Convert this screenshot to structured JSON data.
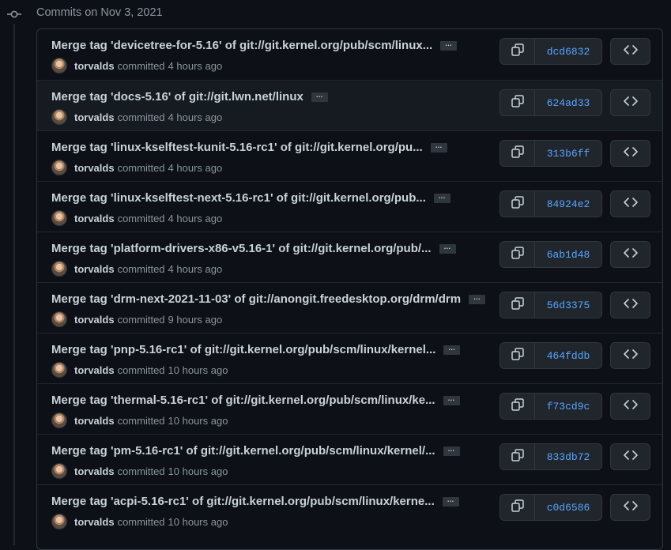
{
  "header": {
    "title": "Commits on Nov 3, 2021"
  },
  "commits": [
    {
      "title": "Merge tag 'devicetree-for-5.16' of git://git.kernel.org/pub/scm/linux...",
      "author": "torvalds",
      "verb": "committed",
      "time": "4 hours ago",
      "sha": "dcd6832"
    },
    {
      "title": "Merge tag 'docs-5.16' of git://git.lwn.net/linux",
      "author": "torvalds",
      "verb": "committed",
      "time": "4 hours ago",
      "sha": "624ad33"
    },
    {
      "title": "Merge tag 'linux-kselftest-kunit-5.16-rc1' of git://git.kernel.org/pu...",
      "author": "torvalds",
      "verb": "committed",
      "time": "4 hours ago",
      "sha": "313b6ff"
    },
    {
      "title": "Merge tag 'linux-kselftest-next-5.16-rc1' of git://git.kernel.org/pub...",
      "author": "torvalds",
      "verb": "committed",
      "time": "4 hours ago",
      "sha": "84924e2"
    },
    {
      "title": "Merge tag 'platform-drivers-x86-v5.16-1' of git://git.kernel.org/pub/...",
      "author": "torvalds",
      "verb": "committed",
      "time": "4 hours ago",
      "sha": "6ab1d48"
    },
    {
      "title": "Merge tag 'drm-next-2021-11-03' of git://anongit.freedesktop.org/drm/drm",
      "author": "torvalds",
      "verb": "committed",
      "time": "9 hours ago",
      "sha": "56d3375"
    },
    {
      "title": "Merge tag 'pnp-5.16-rc1' of git://git.kernel.org/pub/scm/linux/kernel...",
      "author": "torvalds",
      "verb": "committed",
      "time": "10 hours ago",
      "sha": "464fddb"
    },
    {
      "title": "Merge tag 'thermal-5.16-rc1' of git://git.kernel.org/pub/scm/linux/ke...",
      "author": "torvalds",
      "verb": "committed",
      "time": "10 hours ago",
      "sha": "f73cd9c"
    },
    {
      "title": "Merge tag 'pm-5.16-rc1' of git://git.kernel.org/pub/scm/linux/kernel/...",
      "author": "torvalds",
      "verb": "committed",
      "time": "10 hours ago",
      "sha": "833db72"
    },
    {
      "title": "Merge tag 'acpi-5.16-rc1' of git://git.kernel.org/pub/scm/linux/kerne...",
      "author": "torvalds",
      "verb": "committed",
      "time": "10 hours ago",
      "sha": "c0d6586"
    }
  ],
  "ellipsis_label": "…",
  "colors": {
    "background": "#0d1117",
    "sha_link": "#58a6ff",
    "muted_text": "#8b949e",
    "border": "#30363d"
  },
  "icons": {
    "timeline": "git-commit-icon",
    "copy": "copy-icon",
    "browse": "code-icon"
  }
}
